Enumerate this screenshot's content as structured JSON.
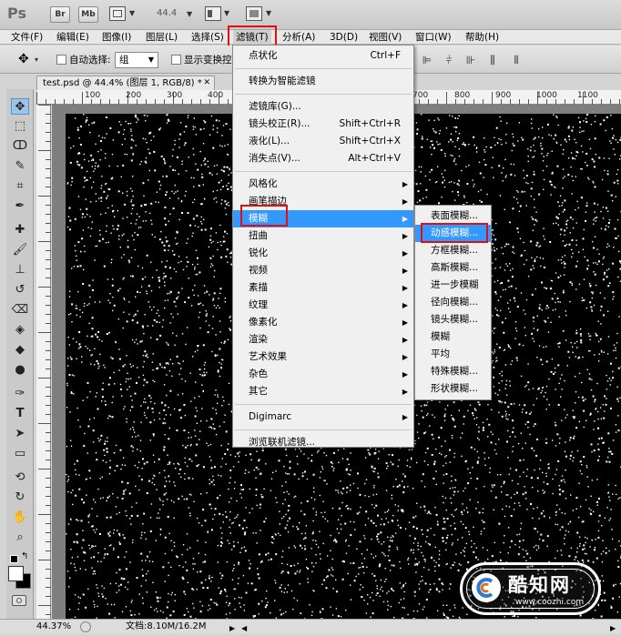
{
  "app": {
    "logo": "Ps",
    "br_button": "Br",
    "mb_button": "Mb",
    "zoom_value": "44.4"
  },
  "menubar": [
    {
      "label": "文件(F)"
    },
    {
      "label": "编辑(E)"
    },
    {
      "label": "图像(I)"
    },
    {
      "label": "图层(L)"
    },
    {
      "label": "选择(S)"
    },
    {
      "label": "滤镜(T)"
    },
    {
      "label": "分析(A)"
    },
    {
      "label": "3D(D)"
    },
    {
      "label": "视图(V)"
    },
    {
      "label": "窗口(W)"
    },
    {
      "label": "帮助(H)"
    }
  ],
  "options": {
    "auto_select_label": "自动选择:",
    "auto_select_value": "组",
    "show_transform_label": "显示变换控"
  },
  "document": {
    "tab_title": "test.psd @ 44.4% (图层 1, RGB/8) *",
    "close_glyph": "✕"
  },
  "ruler": {
    "h_numbers": [
      "100",
      "200",
      "300",
      "400",
      "700",
      "800",
      "900",
      "1000",
      "1100"
    ],
    "v_numbers": []
  },
  "status": {
    "zoom": "44.37%",
    "doc_size": "文档:8.10M/16.2M"
  },
  "filter_menu": {
    "items": [
      {
        "label": "点状化",
        "shortcut": "Ctrl+F"
      },
      {
        "sep": true
      },
      {
        "label": "转换为智能滤镜"
      },
      {
        "sep": true
      },
      {
        "label": "滤镜库(G)..."
      },
      {
        "label": "镜头校正(R)...",
        "shortcut": "Shift+Ctrl+R"
      },
      {
        "label": "液化(L)...",
        "shortcut": "Shift+Ctrl+X"
      },
      {
        "label": "消失点(V)...",
        "shortcut": "Alt+Ctrl+V"
      },
      {
        "sep": true
      },
      {
        "label": "风格化",
        "sub": true
      },
      {
        "label": "画笔描边",
        "sub": true
      },
      {
        "label": "模糊",
        "sub": true,
        "highlight": true
      },
      {
        "label": "扭曲",
        "sub": true
      },
      {
        "label": "锐化",
        "sub": true
      },
      {
        "label": "视频",
        "sub": true
      },
      {
        "label": "素描",
        "sub": true
      },
      {
        "label": "纹理",
        "sub": true
      },
      {
        "label": "像素化",
        "sub": true
      },
      {
        "label": "渲染",
        "sub": true
      },
      {
        "label": "艺术效果",
        "sub": true
      },
      {
        "label": "杂色",
        "sub": true
      },
      {
        "label": "其它",
        "sub": true
      },
      {
        "sep": true
      },
      {
        "label": "Digimarc",
        "sub": true
      },
      {
        "sep": true
      },
      {
        "label": "浏览联机滤镜..."
      }
    ]
  },
  "blur_submenu": {
    "items": [
      {
        "label": "表面模糊..."
      },
      {
        "label": "动感模糊...",
        "highlight": true
      },
      {
        "label": "方框模糊..."
      },
      {
        "label": "高斯模糊..."
      },
      {
        "label": "进一步模糊"
      },
      {
        "label": "径向模糊..."
      },
      {
        "label": "镜头模糊..."
      },
      {
        "label": "模糊"
      },
      {
        "label": "平均"
      },
      {
        "label": "特殊模糊..."
      },
      {
        "label": "形状模糊..."
      }
    ]
  },
  "watermark": {
    "brand": "酷知网",
    "url": "www.coozhi.com"
  },
  "colors": {
    "highlight": "#3399ff",
    "annotation_red": "#e01010",
    "canvas": "#000000"
  }
}
